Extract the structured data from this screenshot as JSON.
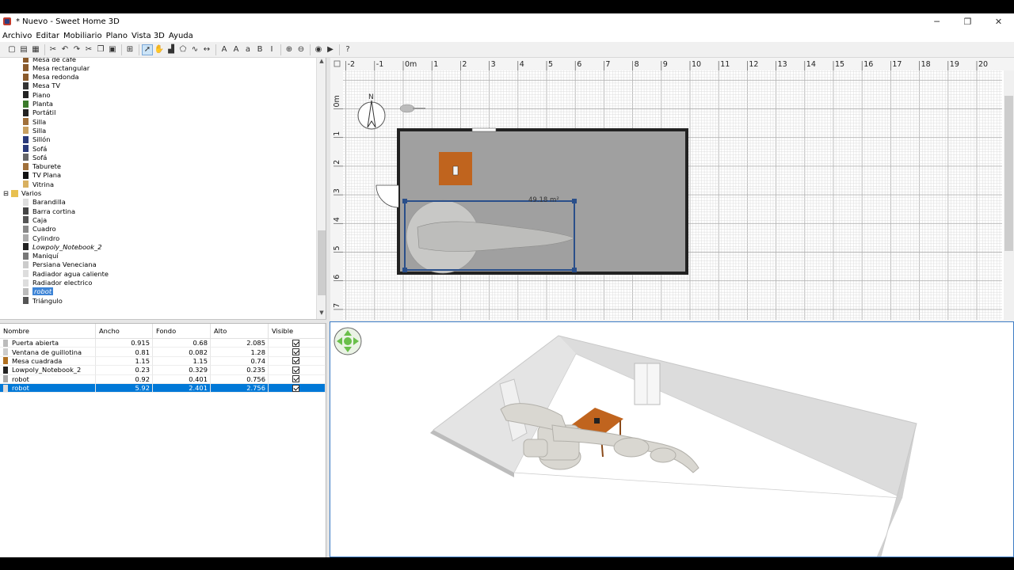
{
  "window": {
    "title": "* Nuevo - Sweet Home 3D",
    "minimize": "─",
    "maximize": "❐",
    "close": "✕"
  },
  "menu": [
    "Archivo",
    "Editar",
    "Mobiliario",
    "Plano",
    "Vista 3D",
    "Ayuda"
  ],
  "toolbar": {
    "icons": [
      "new-icon",
      "open-icon",
      "save-icon",
      "cut-tool-icon",
      "undo-icon",
      "redo-icon",
      "cut-icon",
      "copy-icon",
      "paste-icon",
      "add-furniture-icon",
      "select-icon",
      "pan-icon",
      "create-walls-icon",
      "create-rooms-icon",
      "create-polylines-icon",
      "create-dimensions-icon",
      "add-text-icon",
      "increase-text-icon",
      "decrease-text-icon",
      "bold-icon",
      "italic-icon",
      "zoom-in-icon",
      "zoom-out-icon",
      "photo-icon",
      "video-icon",
      "help-icon"
    ]
  },
  "catalog": {
    "items": [
      {
        "label": "Mesa de café",
        "indent": 2,
        "icon": "table-icon",
        "color": "#8a5a2b"
      },
      {
        "label": "Mesa rectangular",
        "indent": 2,
        "icon": "table-icon",
        "color": "#8a5a2b"
      },
      {
        "label": "Mesa redonda",
        "indent": 2,
        "icon": "table-icon",
        "color": "#8a5a2b"
      },
      {
        "label": "Mesa TV",
        "indent": 2,
        "icon": "tv-table-icon",
        "color": "#333333"
      },
      {
        "label": "Piano",
        "indent": 2,
        "icon": "piano-icon",
        "color": "#222222"
      },
      {
        "label": "Planta",
        "indent": 2,
        "icon": "plant-icon",
        "color": "#3a7a2a"
      },
      {
        "label": "Portátil",
        "indent": 2,
        "icon": "laptop-icon",
        "color": "#222222"
      },
      {
        "label": "Silla",
        "indent": 2,
        "icon": "chair-icon",
        "color": "#a0703a"
      },
      {
        "label": "Silla",
        "indent": 2,
        "icon": "chair-icon",
        "color": "#c8a060"
      },
      {
        "label": "Sillón",
        "indent": 2,
        "icon": "armchair-icon",
        "color": "#2a3a7a"
      },
      {
        "label": "Sofá",
        "indent": 2,
        "icon": "sofa-icon",
        "color": "#2a3a7a"
      },
      {
        "label": "Sofá",
        "indent": 2,
        "icon": "sofa-icon",
        "color": "#666666"
      },
      {
        "label": "Taburete",
        "indent": 2,
        "icon": "stool-icon",
        "color": "#a0703a"
      },
      {
        "label": "TV Plana",
        "indent": 2,
        "icon": "tv-icon",
        "color": "#111111"
      },
      {
        "label": "Vitrina",
        "indent": 2,
        "icon": "cabinet-icon",
        "color": "#d8b060"
      },
      {
        "label": "Varios",
        "indent": 1,
        "icon": "folder-icon",
        "color": "#e8c050",
        "expander": "⊟"
      },
      {
        "label": "Barandilla",
        "indent": 2,
        "icon": "railing-icon",
        "color": "#dddddd"
      },
      {
        "label": "Barra cortina",
        "indent": 2,
        "icon": "curtain-rod-icon",
        "color": "#444444"
      },
      {
        "label": "Caja",
        "indent": 2,
        "icon": "box-icon",
        "color": "#555555"
      },
      {
        "label": "Cuadro",
        "indent": 2,
        "icon": "picture-icon",
        "color": "#888888"
      },
      {
        "label": "Cylindro",
        "indent": 2,
        "icon": "cylinder-icon",
        "color": "#aaaaaa"
      },
      {
        "label": "Lowpoly_Notebook_2",
        "indent": 2,
        "icon": "notebook-icon",
        "color": "#222222",
        "italic": true
      },
      {
        "label": "Maniquí",
        "indent": 2,
        "icon": "mannequin-icon",
        "color": "#777777"
      },
      {
        "label": "Persiana Veneciana",
        "indent": 2,
        "icon": "blind-icon",
        "color": "#cccccc"
      },
      {
        "label": "Radiador agua caliente",
        "indent": 2,
        "icon": "radiator-icon",
        "color": "#dddddd"
      },
      {
        "label": "Radiador electrico",
        "indent": 2,
        "icon": "radiator-icon",
        "color": "#dddddd"
      },
      {
        "label": "robot",
        "indent": 2,
        "icon": "robot-icon",
        "color": "#bbbbbb",
        "selected": true
      },
      {
        "label": "Triángulo",
        "indent": 2,
        "icon": "triangle-icon",
        "color": "#555555"
      }
    ]
  },
  "furniture_table": {
    "columns": [
      "Nombre",
      "Ancho",
      "Fondo",
      "Alto",
      "Visible"
    ],
    "rows": [
      {
        "name": "Puerta abierta",
        "width": "0.915",
        "depth": "0.68",
        "height": "2.085",
        "visible": true,
        "icon": "door-icon",
        "color": "#bbbbbb"
      },
      {
        "name": "Ventana de guillotina",
        "width": "0.81",
        "depth": "0.082",
        "height": "1.28",
        "visible": true,
        "icon": "window-icon",
        "color": "#cccccc"
      },
      {
        "name": "Mesa cuadrada",
        "width": "1.15",
        "depth": "1.15",
        "height": "0.74",
        "visible": true,
        "icon": "table-icon",
        "color": "#b07020"
      },
      {
        "name": "Lowpoly_Notebook_2",
        "width": "0.23",
        "depth": "0.329",
        "height": "0.235",
        "visible": true,
        "icon": "notebook-icon",
        "color": "#222222"
      },
      {
        "name": "robot",
        "width": "0.92",
        "depth": "0.401",
        "height": "0.756",
        "visible": true,
        "icon": "robot-icon",
        "color": "#aaaaaa"
      },
      {
        "name": "robot",
        "width": "5.92",
        "depth": "2.401",
        "height": "2.756",
        "visible": true,
        "icon": "robot-icon",
        "color": "#dddddd",
        "selected": true
      }
    ]
  },
  "plan": {
    "ruler_x": [
      "-2",
      "-1",
      "0m",
      "1",
      "2",
      "3",
      "4",
      "5",
      "6",
      "7",
      "8",
      "9",
      "10",
      "11",
      "12",
      "13",
      "14",
      "15",
      "16",
      "17",
      "18",
      "19",
      "20"
    ],
    "ruler_y": [
      "0m",
      "1",
      "2",
      "3",
      "4",
      "5",
      "6",
      "7"
    ],
    "room_area": "49.18 m²",
    "colors": {
      "floor": "#a0a0a0",
      "table": "#c0641e",
      "selection": "#2a4f8a",
      "grid_minor": "#dcdcdc",
      "grid_major": "#b4b4b4"
    }
  },
  "view3d": {
    "colors": {
      "wall": "#f4f4f4",
      "floor": "#ffffff",
      "table": "#c0641e",
      "robot": "#d8d6d0"
    }
  }
}
